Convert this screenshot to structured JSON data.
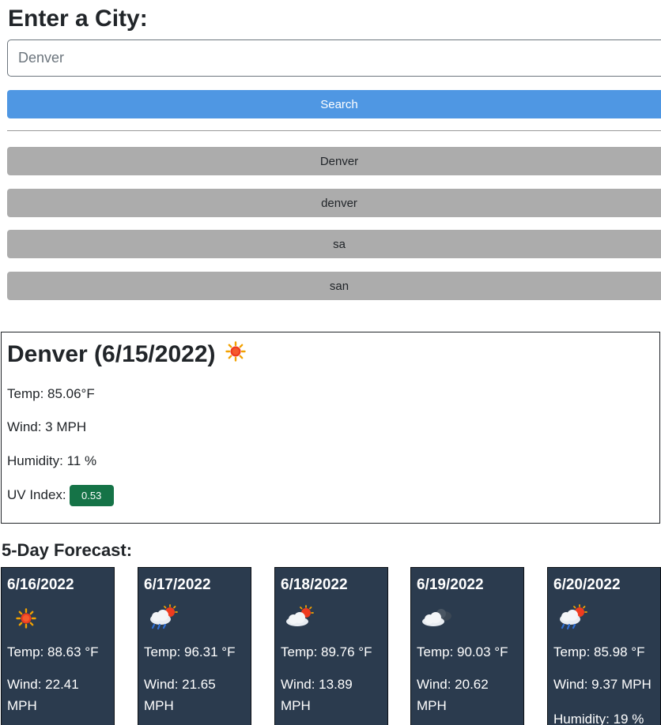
{
  "search": {
    "title": "Enter a City:",
    "input_value": "Denver",
    "search_label": "Search"
  },
  "history": [
    "Denver",
    "denver",
    "sa",
    "san"
  ],
  "current": {
    "heading": "Denver (6/15/2022)",
    "icon": "sun-icon",
    "temp": "Temp: 85.06°F",
    "wind": "Wind: 3 MPH",
    "humidity": "Humidity: 11 %",
    "uv_label": "UV Index:",
    "uv_value": "0.53",
    "uv_color": "#157347"
  },
  "forecast": {
    "title": "5-Day Forecast:",
    "days": [
      {
        "date": "6/16/2022",
        "icon": "sun-icon",
        "temp": "Temp: 88.63 °F",
        "wind": "Wind: 22.41 MPH"
      },
      {
        "date": "6/17/2022",
        "icon": "sun-rain-cloud-icon",
        "temp": "Temp: 96.31 °F",
        "wind": "Wind: 21.65 MPH"
      },
      {
        "date": "6/18/2022",
        "icon": "sun-cloud-icon",
        "temp": "Temp: 89.76 °F",
        "wind": "Wind: 13.89 MPH"
      },
      {
        "date": "6/19/2022",
        "icon": "moon-cloud-icon",
        "temp": "Temp: 90.03 °F",
        "wind": "Wind: 20.62 MPH"
      },
      {
        "date": "6/20/2022",
        "icon": "sun-rain-cloud-icon",
        "temp": "Temp: 85.98 °F",
        "wind": "Wind: 9.37 MPH",
        "humidity": "Humidity: 19 %"
      }
    ]
  },
  "colors": {
    "search_button": "#4f97e3",
    "history_button": "#acacac",
    "forecast_card": "#2b3b4e"
  }
}
